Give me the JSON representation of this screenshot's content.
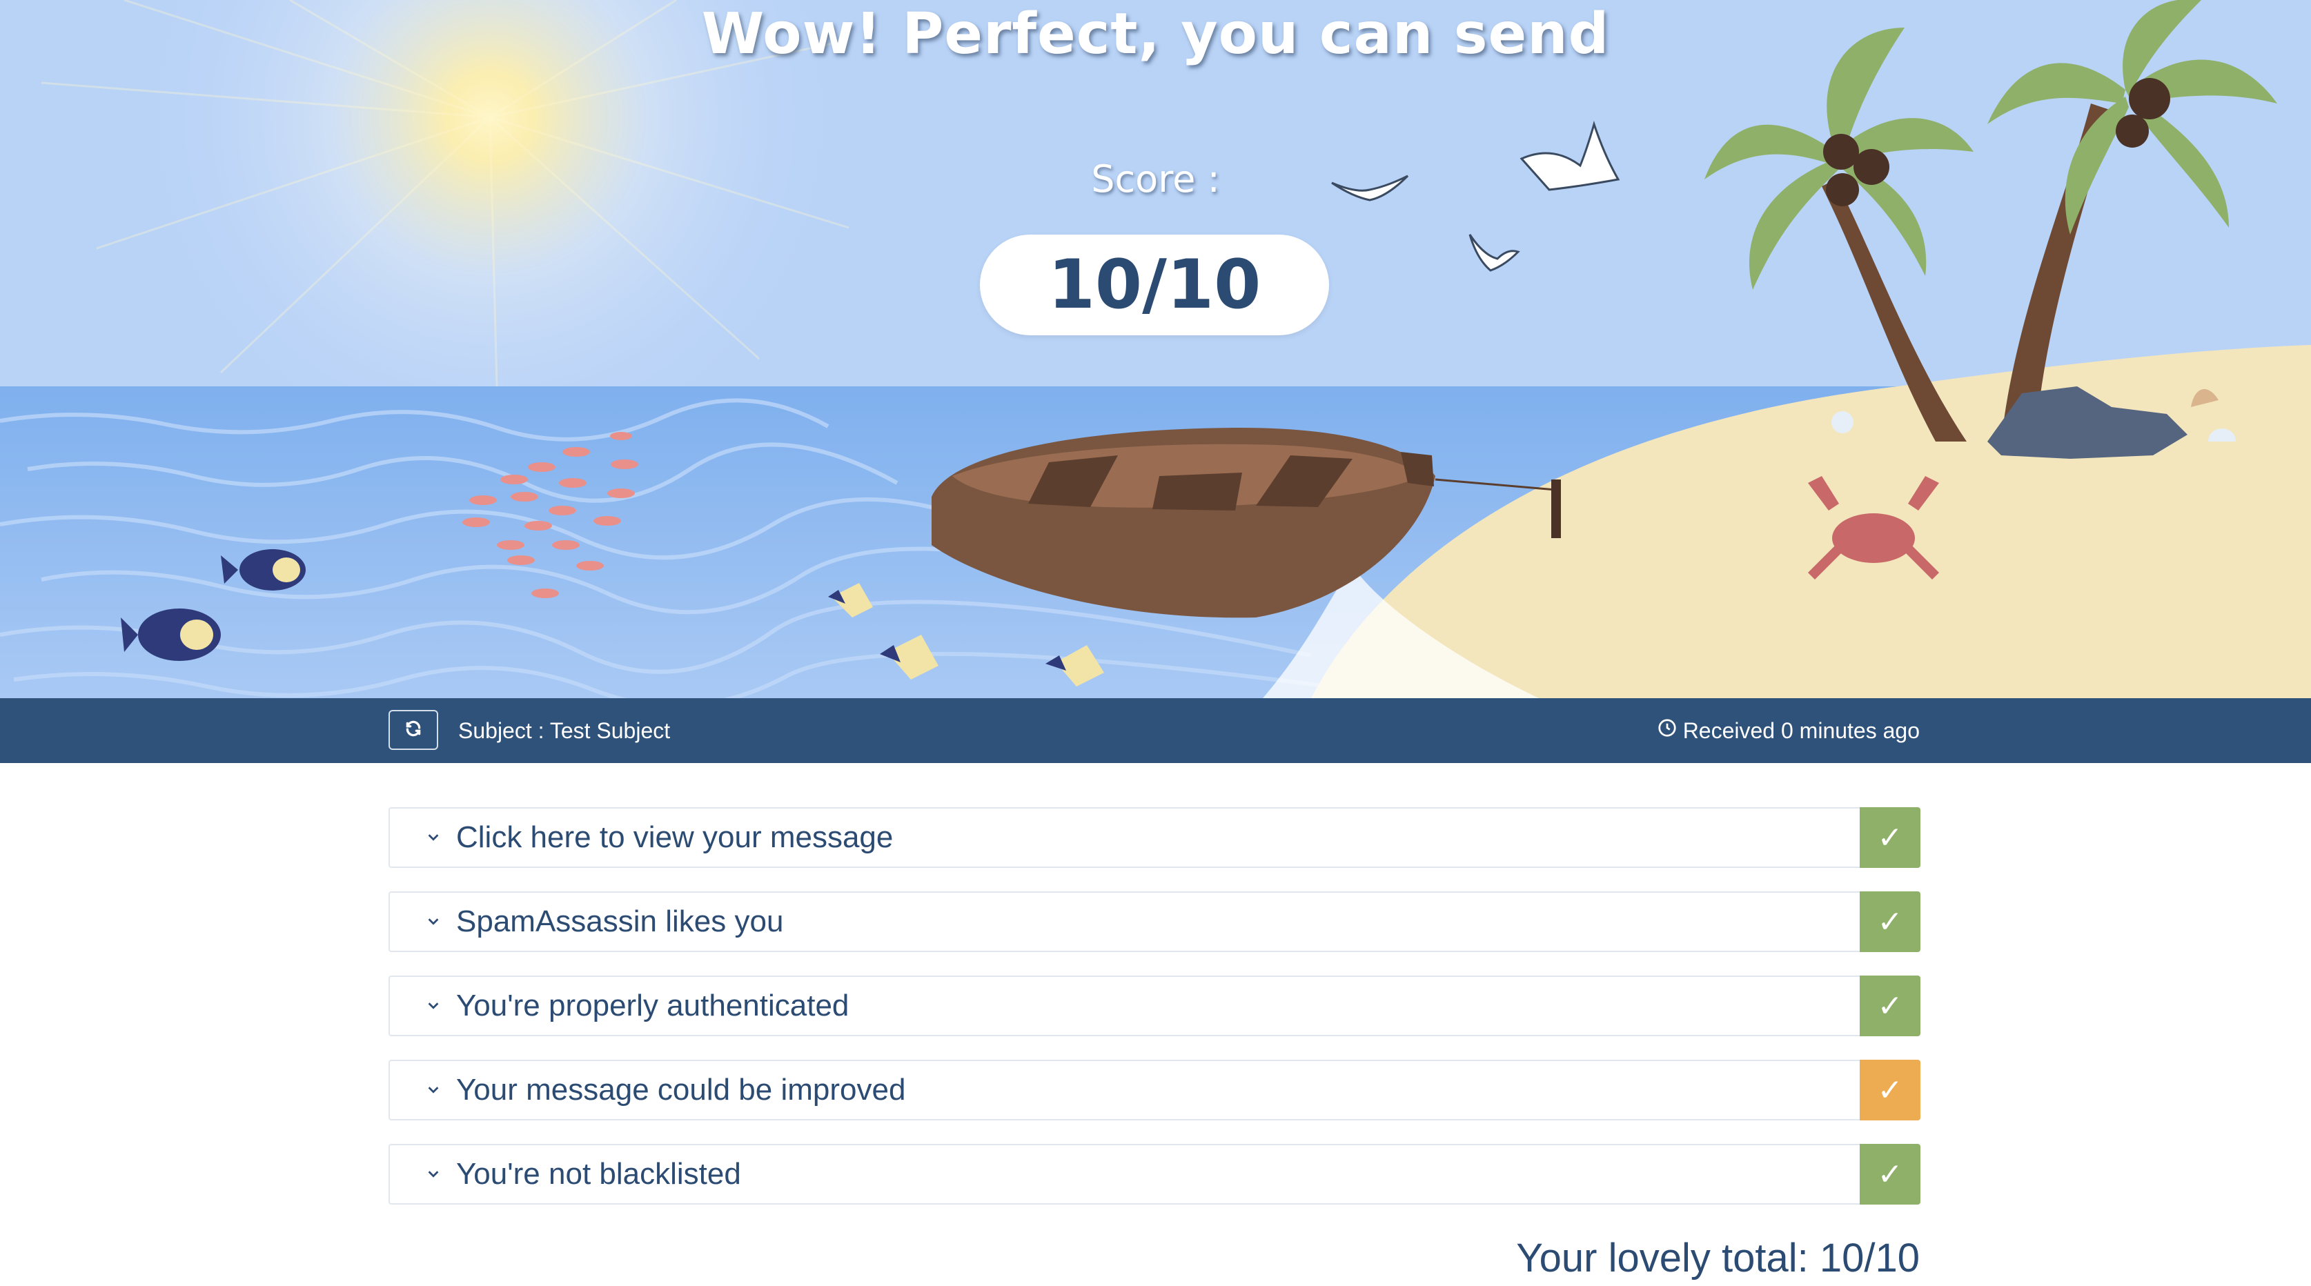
{
  "hero": {
    "title": "Wow! Perfect, you can send",
    "score_label": "Score :",
    "score_value": "10/10"
  },
  "bar": {
    "refresh_icon": "refresh-icon",
    "subject": "Subject : Test Subject",
    "clock_icon": "clock-icon",
    "received": "Received 0 minutes ago"
  },
  "checks": [
    {
      "label": "Click here to view your message",
      "status": "pass",
      "mark": "✓",
      "color": "#8fb069"
    },
    {
      "label": "SpamAssassin likes you",
      "status": "pass",
      "mark": "✓",
      "color": "#8fb069"
    },
    {
      "label": "You're properly authenticated",
      "status": "pass",
      "mark": "✓",
      "color": "#8fb069"
    },
    {
      "label": "Your message could be improved",
      "status": "warning",
      "mark": "✓",
      "color": "#edac52"
    },
    {
      "label": "You're not blacklisted",
      "status": "pass",
      "mark": "✓",
      "color": "#8fb069"
    }
  ],
  "total": "Your lovely total: 10/10",
  "colors": {
    "navy": "#2f527b",
    "text": "#2c4b73",
    "pass": "#8fb069",
    "warning": "#edac52",
    "sky": "#b9d3f7",
    "sea": "#8ab5ec",
    "sand": "#f3e6bd"
  }
}
